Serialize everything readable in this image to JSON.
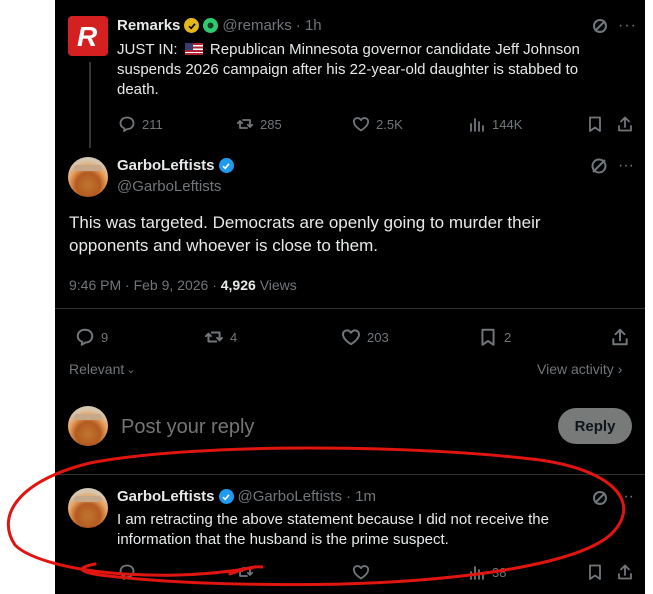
{
  "quoted_post": {
    "display_name": "Remarks",
    "handle": "@remarks",
    "time": "· 1h",
    "text_prefix": "JUST IN:",
    "text": "Republican Minnesota governor candidate Jeff Johnson suspends 2026 campaign after his 22-year-old daughter is stabbed to death.",
    "replies": "211",
    "reposts": "285",
    "likes": "2.5K",
    "views": "144K"
  },
  "main_post": {
    "display_name": "GarboLeftists",
    "handle": "@GarboLeftists",
    "text": "This was targeted. Democrats are openly going to murder their opponents and whoever is close to them.",
    "timestamp": "9:46 PM · Feb 9, 2026 ·",
    "views_count": "4,926",
    "views_label": "Views",
    "replies": "9",
    "reposts": "4",
    "likes": "203",
    "bookmarks": "2"
  },
  "sort": {
    "label": "Relevant",
    "view_activity": "View activity"
  },
  "reply_box": {
    "placeholder": "Post your reply",
    "button": "Reply"
  },
  "reply_post": {
    "display_name": "GarboLeftists",
    "handle": "@GarboLeftists",
    "time": "· 1m",
    "text": "I am retracting the above statement because I did not receive the information that the husband is the prime suspect.",
    "views": "38"
  },
  "colors": {
    "verified_gold": "#e2b719",
    "verified_blue": "#1d9bf0",
    "annotation_red": "#e0150f",
    "reply_button_bg": "#eff3f4"
  }
}
